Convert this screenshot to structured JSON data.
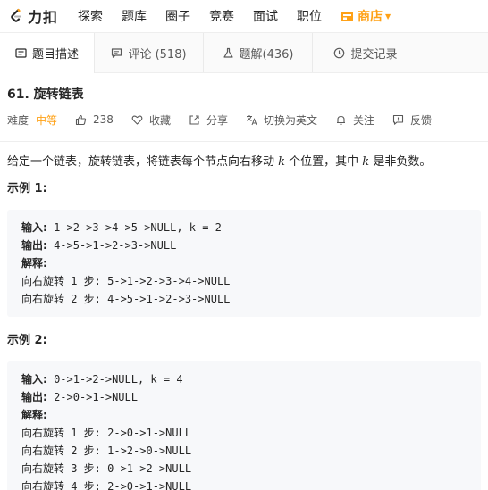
{
  "brand": {
    "name": "力扣",
    "accent": "#ffa116"
  },
  "nav": {
    "items": [
      "探索",
      "题库",
      "圈子",
      "竞赛",
      "面试",
      "职位"
    ],
    "store": "商店"
  },
  "tabs": [
    {
      "label": "题目描述",
      "icon": "description-icon"
    },
    {
      "label": "评论 (518)",
      "icon": "comment-icon"
    },
    {
      "label": "题解(436)",
      "icon": "flask-icon"
    },
    {
      "label": "提交记录",
      "icon": "clock-icon"
    }
  ],
  "problem": {
    "title": "61. 旋转链表",
    "difficulty_label": "难度",
    "difficulty": "中等",
    "likes": "238",
    "favorite": "收藏",
    "share": "分享",
    "translate": "切换为英文",
    "follow": "关注",
    "feedback": "反馈"
  },
  "description": {
    "part1": "给定一个链表，旋转链表，将链表每个节点向右移动 ",
    "var_k1": "k",
    "part2": " 个位置，其中 ",
    "var_k2": "k",
    "part3": " 是非负数。"
  },
  "examples": [
    {
      "title": "示例 1:",
      "input_label": "输入",
      "input": "1->2->3->4->5->NULL, k = 2",
      "output_label": "输出",
      "output": "4->5->1->2->3->NULL",
      "explain_label": "解释",
      "steps": [
        "向右旋转 1 步: 5->1->2->3->4->NULL",
        "向右旋转 2 步: 4->5->1->2->3->NULL"
      ]
    },
    {
      "title": "示例 2:",
      "input_label": "输入",
      "input": "0->1->2->NULL, k = 4",
      "output_label": "输出",
      "output": "2->0->1->NULL",
      "explain_label": "解释",
      "steps": [
        "向右旋转 1 步: 2->0->1->NULL",
        "向右旋转 2 步: 1->2->0->NULL",
        "向右旋转 3 步: 0->1->2->NULL",
        "向右旋转 4 步: 2->0->1->NULL"
      ]
    }
  ]
}
